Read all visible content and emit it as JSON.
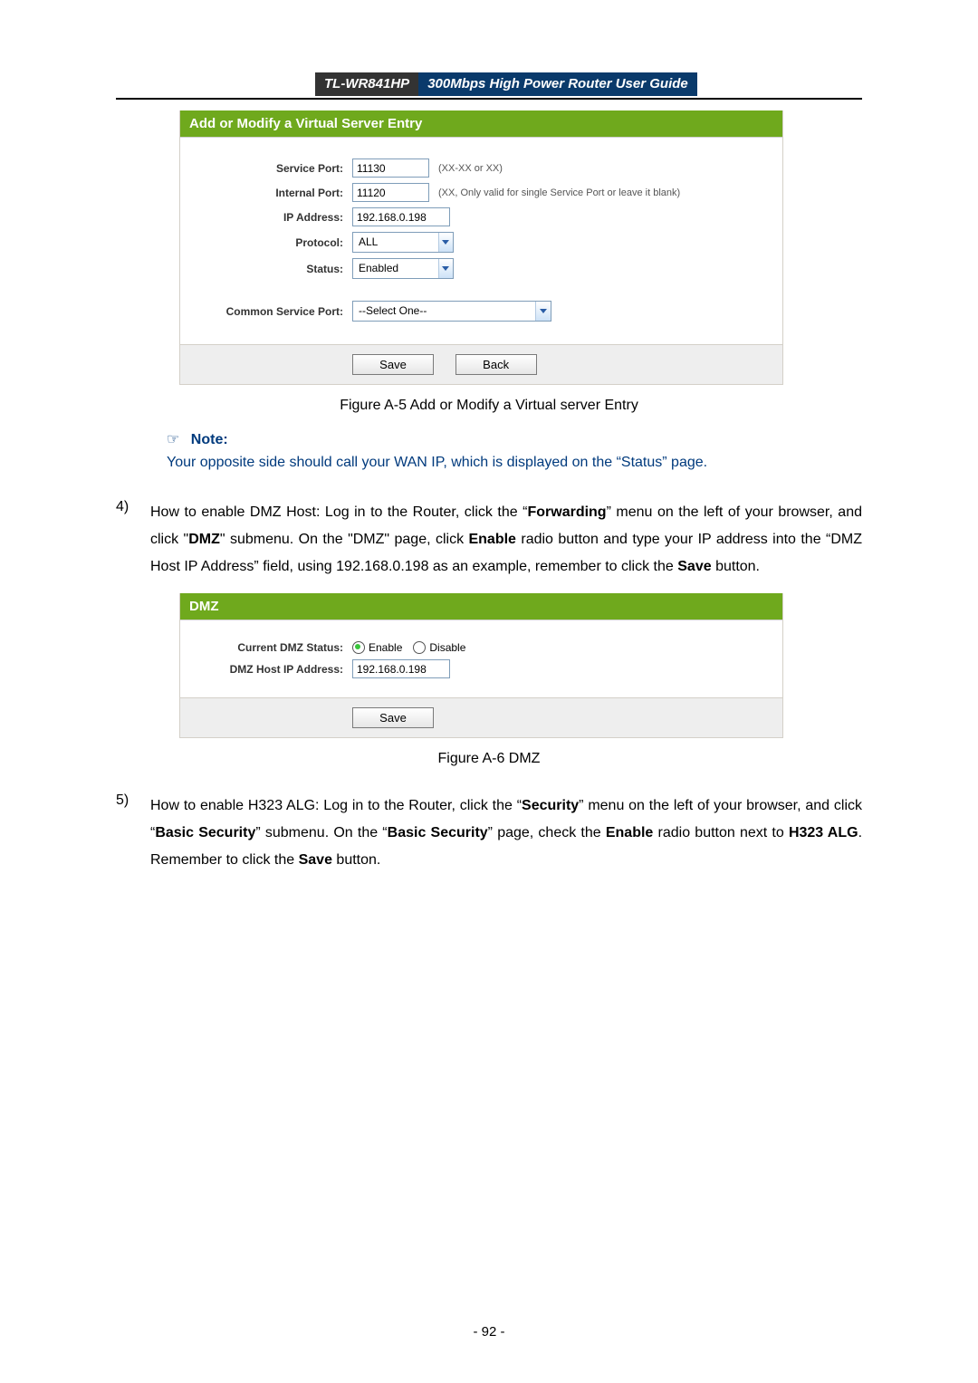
{
  "header": {
    "model": "TL-WR841HP",
    "guide": "300Mbps High Power Router User Guide"
  },
  "fig1": {
    "title": "Add or Modify a Virtual Server Entry",
    "labels": {
      "service_port": "Service Port:",
      "internal_port": "Internal Port:",
      "ip_address": "IP Address:",
      "protocol": "Protocol:",
      "status": "Status:",
      "common": "Common Service Port:"
    },
    "values": {
      "service_port": "11130",
      "internal_port": "11120",
      "ip_address": "192.168.0.198",
      "protocol": "ALL",
      "status": "Enabled",
      "common": "--Select One--"
    },
    "hints": {
      "service_port": "(XX-XX or XX)",
      "internal_port": "(XX, Only valid for single Service Port or leave it blank)"
    },
    "buttons": {
      "save": "Save",
      "back": "Back"
    },
    "caption": "Figure A-5    Add or Modify a Virtual server Entry"
  },
  "note": {
    "label": "Note:",
    "body": "Your opposite side should call your WAN IP, which is displayed on the “Status” page."
  },
  "step4": {
    "num": "4)",
    "before_fwd": "How to enable DMZ Host: Log in to the Router, click the “",
    "forwarding": "Forwarding",
    "mid1": "” menu on the left of your browser, and click \"",
    "dmz": "DMZ",
    "mid2": "\" submenu. On the \"DMZ\" page, click ",
    "enable": "Enable",
    "mid3": " radio button and type your IP address into the “DMZ Host IP Address” field, using 192.168.0.198 as an example, remember to click the ",
    "save": "Save",
    "after": " button."
  },
  "fig2": {
    "title": "DMZ",
    "labels": {
      "status": "Current DMZ Status:",
      "ip": "DMZ Host IP Address:"
    },
    "radio": {
      "enable": "Enable",
      "disable": "Disable"
    },
    "ip_value": "192.168.0.198",
    "save": "Save",
    "caption": "Figure A-6 DMZ"
  },
  "step5": {
    "num": "5)",
    "p1": "How to enable H323 ALG: Log in to the Router, click the “",
    "security": "Security",
    "p2": "” menu on the left of your browser, and click “",
    "basic1": "Basic Security",
    "p3": "” submenu. On the “",
    "basic2": "Basic Security",
    "p4": "” page, check the ",
    "enable": "Enable",
    "p5": " radio button next to ",
    "h323": "H323 ALG",
    "p6": ". Remember to click the ",
    "save": "Save",
    "p7": " button."
  },
  "page_number": "- 92 -"
}
